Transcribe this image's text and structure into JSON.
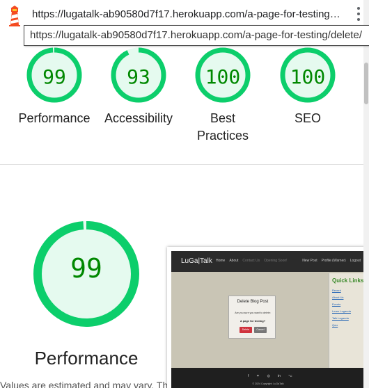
{
  "browser": {
    "url": "https://lugatalk-ab90580d7f17.herokuapp.com/a-page-for-testing…",
    "tooltip": "https://lugatalk-ab90580d7f17.herokuapp.com/a-page-for-testing/delete/"
  },
  "gauges": [
    {
      "score": "99",
      "label": "Performance",
      "value": 0.99
    },
    {
      "score": "93",
      "label": "Accessibility",
      "value": 0.93
    },
    {
      "score": "100",
      "label": "Best",
      "label2": "Practices",
      "value": 1.0
    },
    {
      "score": "100",
      "label": "SEO",
      "value": 1.0
    }
  ],
  "main_gauge": {
    "score": "99",
    "label": "Performance",
    "value": 0.99
  },
  "note": "Values are estimated and may vary. The",
  "colors": {
    "pass": "#0cce6b",
    "pass_fill": "#e5faef",
    "pass_text": "#008800"
  },
  "screenshot": {
    "brand": "LuGa|Talk",
    "nav": [
      "Home",
      "About",
      "Contact Us",
      "Opening Soon!"
    ],
    "nav_right": [
      "New Post",
      "Profile (Warner)",
      "Logout"
    ],
    "modal_title": "Delete Blog Post",
    "modal_text": "Are you sure you want to delete:",
    "modal_post": "A page for testing?",
    "delete_label": "Delete",
    "cancel_label": "Cancel",
    "quick_links_title": "Quick Links!",
    "quick_links": [
      "Recent",
      "About Us",
      "Events",
      "Learn Luganda",
      "Talk Luganda",
      "Quiz"
    ],
    "footer_icons": [
      "f",
      "✦",
      "◎",
      "in",
      "⌥"
    ],
    "copyright": "© 2024 Copyright: LuGaTalk"
  }
}
